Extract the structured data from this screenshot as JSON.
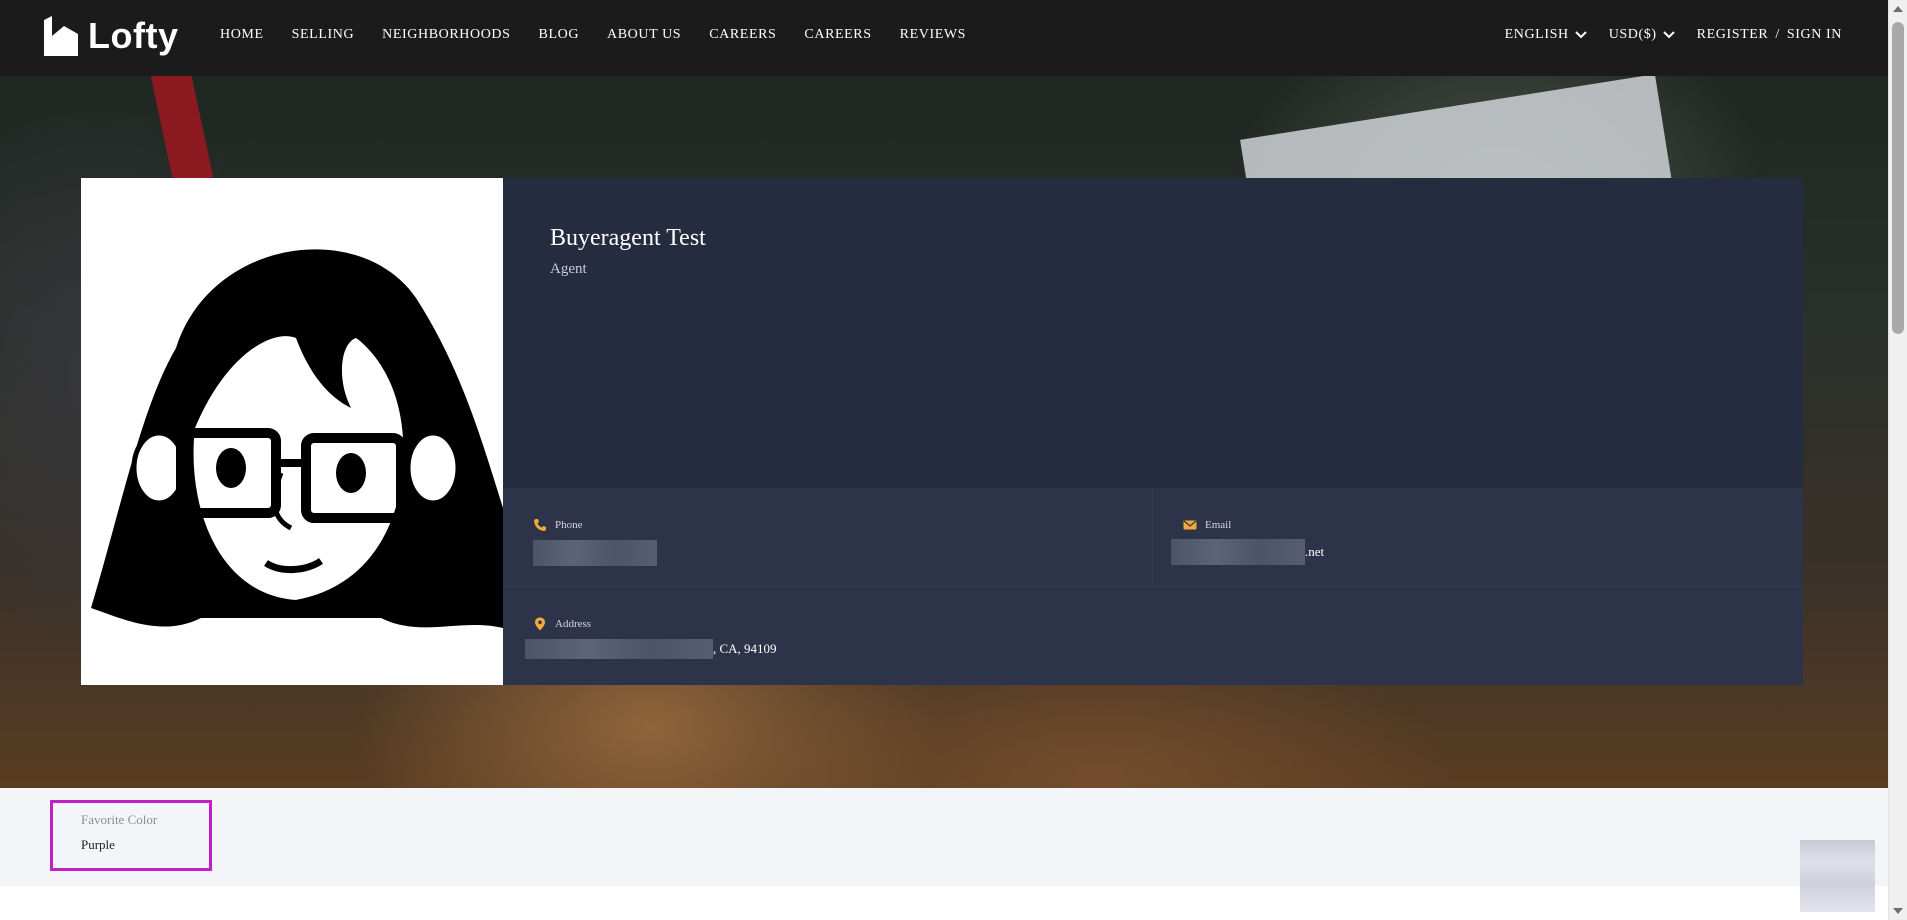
{
  "header": {
    "brand": "Lofty",
    "nav": [
      "HOME",
      "SELLING",
      "NEIGHBORHOODS",
      "BLOG",
      "ABOUT US",
      "CAREERS",
      "CAREERS",
      "REVIEWS"
    ],
    "language": "ENGLISH",
    "currency": "USD($)",
    "register": "REGISTER",
    "separator": "/",
    "sign_in": "SIGN IN"
  },
  "profile": {
    "name": "Buyeragent Test",
    "role": "Agent",
    "avatar": "woman-with-glasses-illustration",
    "phone_label": "Phone",
    "phone_value": "",
    "email_label": "Email",
    "email_suffix": ".net",
    "address_label": "Address",
    "address_suffix": ", CA, 94109"
  },
  "details": {
    "favorite_color_label": "Favorite Color",
    "favorite_color_value": "Purple"
  },
  "colors": {
    "accent_icon": "#f3a93b",
    "highlight_border": "#c11fc9",
    "card_bg": "#262c40"
  },
  "icons": {
    "phone": "phone-icon",
    "email": "envelope-icon",
    "address": "map-pin-icon"
  }
}
